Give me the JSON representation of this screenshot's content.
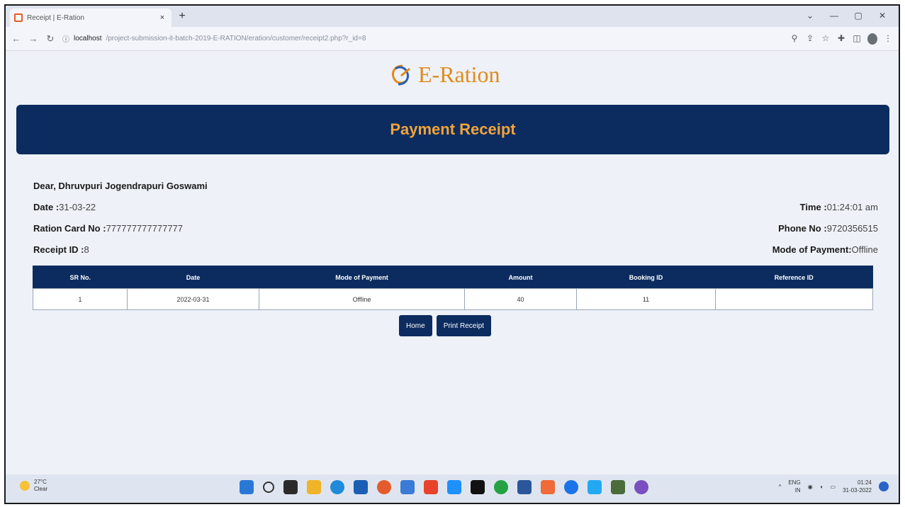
{
  "browser": {
    "tab_title": "Receipt | E-Ration",
    "tab_close": "×",
    "new_tab": "+",
    "url_host": "localhost",
    "url_path": "/project-submission-it-batch-2019-E-RATION/eration/customer/receipt2.php?r_id=8",
    "window_controls": [
      "⌄",
      "—",
      "▢",
      "✕"
    ]
  },
  "logo": {
    "text": "E-Ration",
    "brand_color": "#e18a19"
  },
  "banner": {
    "title": "Payment Receipt",
    "bg_color": "#0c2c60",
    "title_color": "#f2a33a"
  },
  "receipt": {
    "greeting": "Dear, Dhruvpuri Jogendrapuri Goswami",
    "date_label": "Date :",
    "date_value": "31-03-22",
    "time_label": "Time :",
    "time_value": "01:24:01 am",
    "ration_label": "Ration Card No :",
    "ration_value": "777777777777777",
    "phone_label": "Phone No :",
    "phone_value": "9720356515",
    "receipt_id_label": "Receipt ID :",
    "receipt_id_value": "8",
    "mode_label": "Mode of Payment:",
    "mode_value": "Offline"
  },
  "table": {
    "headers": [
      "SR No.",
      "Date",
      "Mode of Payment",
      "Amount",
      "Booking ID",
      "Reference ID"
    ],
    "rows": [
      [
        "1",
        "2022-03-31",
        "Offline",
        "40",
        "11",
        ""
      ]
    ]
  },
  "buttons": {
    "home": "Home",
    "print": "Print Receipt"
  },
  "taskbar": {
    "weather_temp": "27°C",
    "weather_desc": "Clear",
    "lang_1": "ENG",
    "lang_2": "IN",
    "time": "01:24",
    "date": "31-03-2022"
  }
}
